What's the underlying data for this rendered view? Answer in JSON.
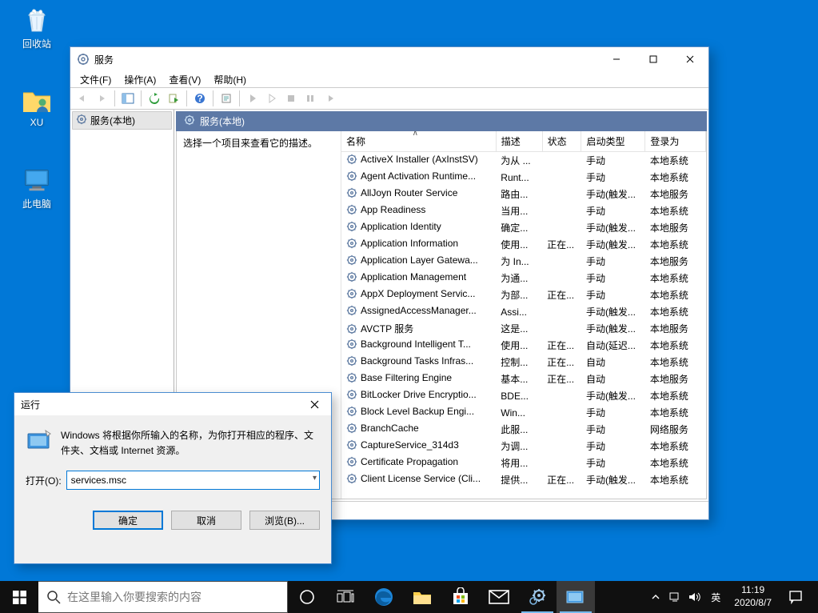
{
  "desktop": {
    "icons": [
      {
        "label": "回收站"
      },
      {
        "label": "XU"
      },
      {
        "label": "此电脑"
      }
    ]
  },
  "services_window": {
    "title": "服务",
    "menus": {
      "file": "文件(F)",
      "action": "操作(A)",
      "view": "查看(V)",
      "help": "帮助(H)"
    },
    "tree_node": "服务(本地)",
    "header_label": "服务(本地)",
    "desc_hint": "选择一个项目来查看它的描述。",
    "columns": {
      "name": "名称",
      "desc": "描述",
      "status": "状态",
      "startup": "启动类型",
      "logon": "登录为"
    },
    "rows": [
      {
        "name": "ActiveX Installer (AxInstSV)",
        "desc": "为从 ...",
        "status": "",
        "startup": "手动",
        "logon": "本地系统"
      },
      {
        "name": "Agent Activation Runtime...",
        "desc": "Runt...",
        "status": "",
        "startup": "手动",
        "logon": "本地系统"
      },
      {
        "name": "AllJoyn Router Service",
        "desc": "路由...",
        "status": "",
        "startup": "手动(触发...",
        "logon": "本地服务"
      },
      {
        "name": "App Readiness",
        "desc": "当用...",
        "status": "",
        "startup": "手动",
        "logon": "本地系统"
      },
      {
        "name": "Application Identity",
        "desc": "确定...",
        "status": "",
        "startup": "手动(触发...",
        "logon": "本地服务"
      },
      {
        "name": "Application Information",
        "desc": "使用...",
        "status": "正在...",
        "startup": "手动(触发...",
        "logon": "本地系统"
      },
      {
        "name": "Application Layer Gatewa...",
        "desc": "为 In...",
        "status": "",
        "startup": "手动",
        "logon": "本地服务"
      },
      {
        "name": "Application Management",
        "desc": "为通...",
        "status": "",
        "startup": "手动",
        "logon": "本地系统"
      },
      {
        "name": "AppX Deployment Servic...",
        "desc": "为部...",
        "status": "正在...",
        "startup": "手动",
        "logon": "本地系统"
      },
      {
        "name": "AssignedAccessManager...",
        "desc": "Assi...",
        "status": "",
        "startup": "手动(触发...",
        "logon": "本地系统"
      },
      {
        "name": "AVCTP 服务",
        "desc": "这是...",
        "status": "",
        "startup": "手动(触发...",
        "logon": "本地服务"
      },
      {
        "name": "Background Intelligent T...",
        "desc": "使用...",
        "status": "正在...",
        "startup": "自动(延迟...",
        "logon": "本地系统"
      },
      {
        "name": "Background Tasks Infras...",
        "desc": "控制...",
        "status": "正在...",
        "startup": "自动",
        "logon": "本地系统"
      },
      {
        "name": "Base Filtering Engine",
        "desc": "基本...",
        "status": "正在...",
        "startup": "自动",
        "logon": "本地服务"
      },
      {
        "name": "BitLocker Drive Encryptio...",
        "desc": "BDE...",
        "status": "",
        "startup": "手动(触发...",
        "logon": "本地系统"
      },
      {
        "name": "Block Level Backup Engi...",
        "desc": "Win...",
        "status": "",
        "startup": "手动",
        "logon": "本地系统"
      },
      {
        "name": "BranchCache",
        "desc": "此服...",
        "status": "",
        "startup": "手动",
        "logon": "网络服务"
      },
      {
        "name": "CaptureService_314d3",
        "desc": "为调...",
        "status": "",
        "startup": "手动",
        "logon": "本地系统"
      },
      {
        "name": "Certificate Propagation",
        "desc": "将用...",
        "status": "",
        "startup": "手动",
        "logon": "本地系统"
      },
      {
        "name": "Client License Service (Cli...",
        "desc": "提供...",
        "status": "正在...",
        "startup": "手动(触发...",
        "logon": "本地系统"
      }
    ]
  },
  "run_dialog": {
    "title": "运行",
    "description": "Windows 将根据你所输入的名称，为你打开相应的程序、文件夹、文档或 Internet 资源。",
    "open_label": "打开(O):",
    "value": "services.msc",
    "buttons": {
      "ok": "确定",
      "cancel": "取消",
      "browse": "浏览(B)..."
    }
  },
  "taskbar": {
    "search_placeholder": "在这里输入你要搜索的内容",
    "ime": "英",
    "time": "11:19",
    "date": "2020/8/7"
  }
}
